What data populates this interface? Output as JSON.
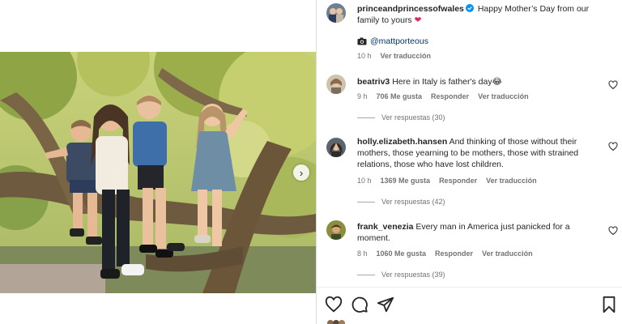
{
  "post": {
    "username": "princeandprincessofwales",
    "caption": "Happy Mother’s Day from our family to yours",
    "caption_emoji": "❤",
    "credit_icon": "camera-icon",
    "credit": "@mattporteous",
    "time": "10 h",
    "translate_label": "Ver traducción"
  },
  "comments": [
    {
      "username": "beatriv3",
      "text": "Here in Italy is father's day",
      "emoji": "😂",
      "time": "9 h",
      "likes": "706 Me gusta",
      "reply_label": "Responder",
      "translate_label": "Ver traducción",
      "replies_label": "Ver respuestas (30)"
    },
    {
      "username": "holly.elizabeth.hansen",
      "text": "And thinking of those without their mothers, those yearning to be mothers, those with strained relations, those who have lost children.",
      "time": "10 h",
      "likes": "1369 Me gusta",
      "reply_label": "Responder",
      "translate_label": "Ver traducción",
      "replies_label": "Ver respuestas (42)"
    },
    {
      "username": "frank_venezia",
      "text": "Every man in America just panicked for a moment.",
      "time": "8 h",
      "likes": "1060 Me gusta",
      "reply_label": "Responder",
      "translate_label": "Ver traducción",
      "replies_label": "Ver respuestas (39)"
    }
  ],
  "icons": {
    "like": "heart-icon",
    "comment": "comment-icon",
    "share": "share-icon",
    "save": "bookmark-icon",
    "next": "chevron-right-icon",
    "verified": "verified-badge-icon"
  },
  "colors": {
    "verified": "#0095f6",
    "heart_emoji": "#e0245e",
    "meta_text": "#737373"
  }
}
